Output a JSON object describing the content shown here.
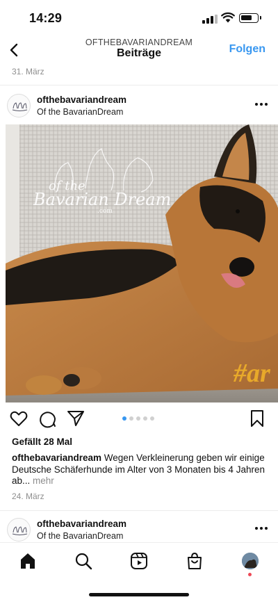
{
  "status": {
    "time": "14:29",
    "battery_level": 0.75
  },
  "nav": {
    "account": "OFTHEBAVARIANDREAM",
    "title": "Beiträge",
    "follow_label": "Folgen"
  },
  "feed": {
    "prev_date": "31. März",
    "post": {
      "username": "ofthebavariandream",
      "subname": "Of the BavarianDream",
      "image": {
        "watermark_line1": "of the",
        "watermark_line2": "Bavarian Dream",
        "watermark_line3": ".com",
        "hashtag": "#ar"
      },
      "carousel": {
        "count": 5,
        "active_index": 0
      },
      "likes": "Gefällt 28 Mal",
      "caption_user": "ofthebavariandream",
      "caption_text": " Wegen Verkleinerung geben wir einige Deutsche Schäferhunde im Alter von 3 Monaten bis 4 Jahren ab...",
      "caption_more": " mehr",
      "date": "24. März"
    },
    "next_post": {
      "username": "ofthebavariandream",
      "subname": "Of the BavarianDream"
    }
  },
  "tabs": [
    "home-icon",
    "search-icon",
    "reels-icon",
    "shop-icon",
    "profile-avatar"
  ],
  "colors": {
    "accent": "#3897f0",
    "notification": "#ed4956",
    "muted": "#8e8e8e"
  }
}
